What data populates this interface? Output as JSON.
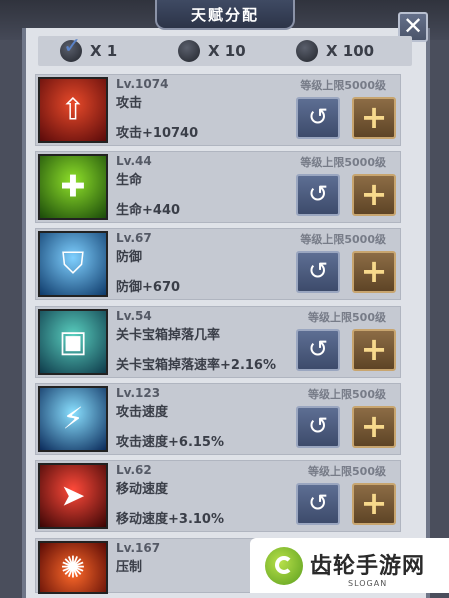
{
  "title": "天赋分配",
  "close_symbol": "✕",
  "multipliers": [
    {
      "label": "X 1",
      "selected": true
    },
    {
      "label": "X 10",
      "selected": false
    },
    {
      "label": "X 100",
      "selected": false
    }
  ],
  "talents": [
    {
      "level": "Lv.1074",
      "name": "攻击",
      "bonus": "攻击+10740",
      "cap": "等级上限5000级",
      "icon": "attack-icon",
      "color": "#b0161a"
    },
    {
      "level": "Lv.44",
      "name": "生命",
      "bonus": "生命+440",
      "cap": "等级上限5000级",
      "icon": "health-icon",
      "color": "#3e9e1c"
    },
    {
      "level": "Lv.67",
      "name": "防御",
      "bonus": "防御+670",
      "cap": "等级上限5000级",
      "icon": "shield-icon",
      "color": "#2a82b8"
    },
    {
      "level": "Lv.54",
      "name": "关卡宝箱掉落几率",
      "bonus": "关卡宝箱掉落速率+2.16%",
      "cap": "等级上限500级",
      "icon": "chest-icon",
      "color": "#1f6e86"
    },
    {
      "level": "Lv.123",
      "name": "攻击速度",
      "bonus": "攻击速度+6.15%",
      "cap": "等级上限500级",
      "icon": "lightning-icon",
      "color": "#1a5f9a"
    },
    {
      "level": "Lv.62",
      "name": "移动速度",
      "bonus": "移动速度+3.10%",
      "cap": "等级上限500级",
      "icon": "speed-icon",
      "color": "#8e1116"
    },
    {
      "level": "Lv.167",
      "name": "压制",
      "bonus": "",
      "cap": "",
      "icon": "suppress-icon",
      "color": "#c01a12"
    }
  ],
  "reset_symbol": "↺",
  "plus_symbol": "+",
  "watermark": {
    "text": "齿轮手游网",
    "sub": "SLOGAN"
  }
}
